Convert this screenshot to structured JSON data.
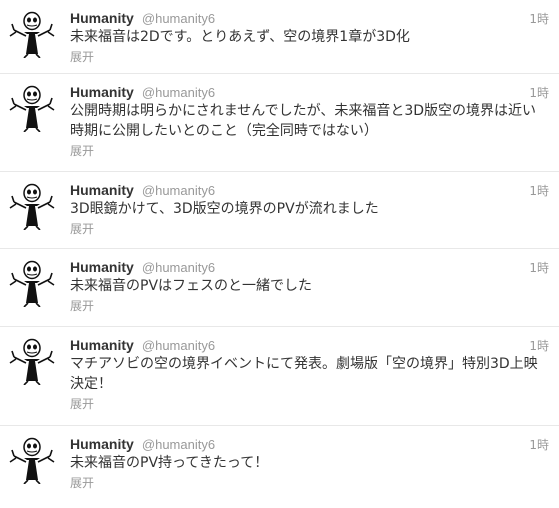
{
  "tweets": [
    {
      "name": "Humanity",
      "handle": "@humanity6",
      "time": "1時",
      "text": "未来福音は2Dです。とりあえず、空の境界1章が3D化",
      "expand": "展开"
    },
    {
      "name": "Humanity",
      "handle": "@humanity6",
      "time": "1時",
      "text": "公開時期は明らかにされませんでしたが、未来福音と3D版空の境界は近い時期に公開したいとのこと（完全同時ではない）",
      "expand": "展开"
    },
    {
      "name": "Humanity",
      "handle": "@humanity6",
      "time": "1時",
      "text": "3D眼鏡かけて、3D版空の境界のPVが流れました",
      "expand": "展开"
    },
    {
      "name": "Humanity",
      "handle": "@humanity6",
      "time": "1時",
      "text": "未来福音のPVはフェスのと一緒でした",
      "expand": "展开"
    },
    {
      "name": "Humanity",
      "handle": "@humanity6",
      "time": "1時",
      "text": "マチアソビの空の境界イベントにて発表。劇場版「空の境界」特別3D上映決定！",
      "expand": "展开"
    },
    {
      "name": "Humanity",
      "handle": "@humanity6",
      "time": "1時",
      "text": "未来福音のPV持ってきたって！",
      "expand": "展开"
    }
  ]
}
